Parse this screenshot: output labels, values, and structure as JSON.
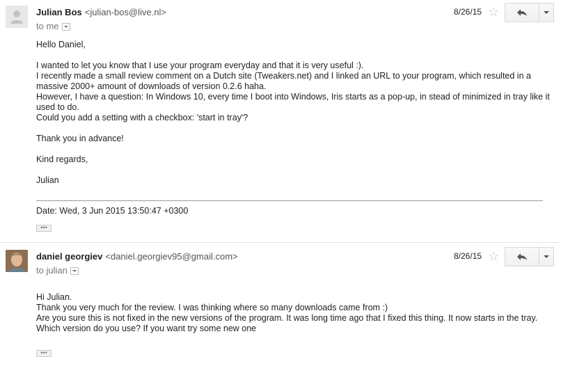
{
  "messages": [
    {
      "sender_name": "Julian Bos",
      "sender_email": "<julian-bos@live.nl>",
      "to_label": "to me",
      "date": "8/26/15",
      "body": [
        "Hello Daniel,",
        "I wanted to let you know that I use your program everyday and that it is very useful :).",
        "I recently made a small review comment on a Dutch site (Tweakers.net) and I linked an URL to your program, which resulted in a massive 2000+ amount of downloads of version 0.2.6 haha.",
        "However, I have a question: In Windows 10, every time I boot into Windows, Iris starts as a pop-up, in stead of minimized in tray like it used to do.",
        "Could you add a setting with a checkbox: 'start in tray'?",
        "Thank you in advance!",
        "Kind regards,",
        "Julian"
      ],
      "quoted_date": "Date: Wed, 3 Jun 2015 13:50:47 +0300",
      "ellipsis": "•••"
    },
    {
      "sender_name": "daniel georgiev",
      "sender_email": "<daniel.georgiev95@gmail.com>",
      "to_label": "to julian",
      "date": "8/26/15",
      "body": [
        "Hi Julian.",
        "Thank you very much for the review. I was thinking where so many downloads came from :)",
        "Are you sure this is not fixed in the new versions of the program. It was long time ago that I fixed this thing. It now starts in the tray. Which version do you use? If you want try some new one"
      ],
      "ellipsis": "•••"
    }
  ],
  "icons": {
    "star": "star-icon",
    "reply": "reply-icon",
    "more": "chevron-down-icon",
    "avatar_generic": "person-icon"
  },
  "colors": {
    "star": "#c7c7c7",
    "divider": "#9a9a9a",
    "button_border": "#d8d8d8"
  }
}
